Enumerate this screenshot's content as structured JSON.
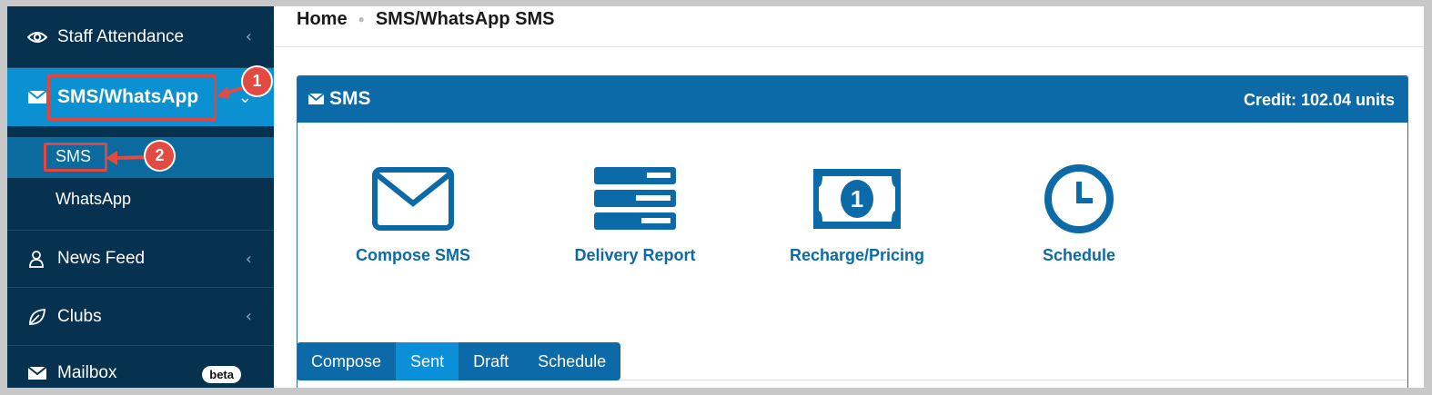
{
  "sidebar": {
    "staff_attendance": "Staff Attendance",
    "sms_whatsapp": "SMS/WhatsApp",
    "sub_sms": "SMS",
    "sub_whatsapp": "WhatsApp",
    "news_feed": "News Feed",
    "clubs": "Clubs",
    "mailbox": "Mailbox",
    "mailbox_badge": "beta"
  },
  "annotations": {
    "step1": "1",
    "step2": "2"
  },
  "breadcrumb": {
    "home": "Home",
    "current": "SMS/WhatsApp SMS"
  },
  "panel": {
    "title": "SMS",
    "credit": "Credit: 102.04 units"
  },
  "tiles": [
    {
      "label": "Compose SMS",
      "icon": "envelope-icon"
    },
    {
      "label": "Delivery Report",
      "icon": "report-list-icon"
    },
    {
      "label": "Recharge/Pricing",
      "icon": "money-icon"
    },
    {
      "label": "Schedule",
      "icon": "clock-icon"
    }
  ],
  "tabs": [
    "Compose",
    "Sent",
    "Draft",
    "Schedule"
  ],
  "active_tab": "Sent",
  "colors": {
    "sidebar": "#07324f",
    "accent": "#0b6aa7",
    "active": "#0b90d2",
    "annotation": "#e34a41"
  }
}
